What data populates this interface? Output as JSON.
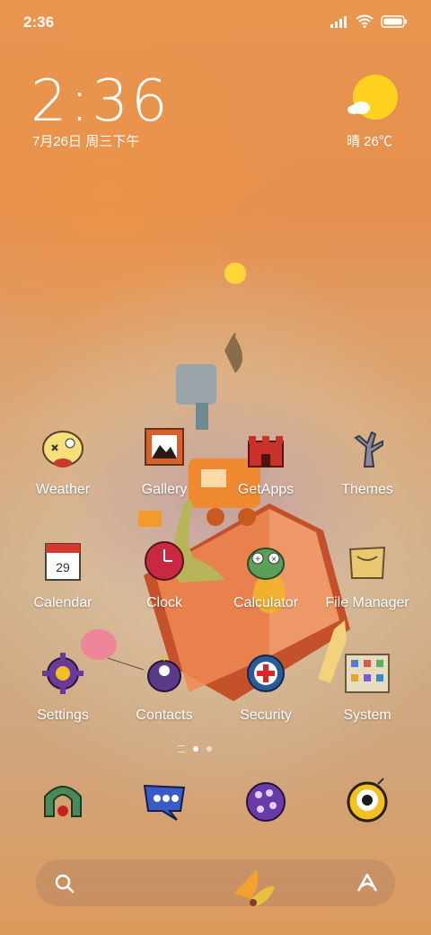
{
  "status_bar": {
    "time": "2:36"
  },
  "clock_widget": {
    "time": "2:36",
    "date": "7月26日 周三下午"
  },
  "weather_widget": {
    "text": "晴 26℃",
    "sun_color": "#ffd21f"
  },
  "apps": [
    {
      "label": "Weather",
      "icon": "bird-weather-icon"
    },
    {
      "label": "Gallery",
      "icon": "picture-frame-icon"
    },
    {
      "label": "GetApps",
      "icon": "castle-icon"
    },
    {
      "label": "Themes",
      "icon": "dead-tree-icon"
    },
    {
      "label": "Calendar",
      "icon": "calendar-page-icon"
    },
    {
      "label": "Clock",
      "icon": "red-clock-icon"
    },
    {
      "label": "Calculator",
      "icon": "frog-calculator-icon"
    },
    {
      "label": "File Manager",
      "icon": "paper-bag-icon"
    },
    {
      "label": "Settings",
      "icon": "purple-gear-icon"
    },
    {
      "label": "Contacts",
      "icon": "purple-monster-icon"
    },
    {
      "label": "Security",
      "icon": "red-cross-shield-icon"
    },
    {
      "label": "System",
      "icon": "map-grid-icon"
    }
  ],
  "dock": [
    {
      "icon": "phone-arch-icon"
    },
    {
      "icon": "message-bubble-icon"
    },
    {
      "icon": "browser-ball-icon"
    },
    {
      "icon": "camera-eye-icon"
    }
  ],
  "search_bar": {
    "search_icon": "search-icon",
    "assistant_icon": "assistant-icon"
  },
  "page_indicator": {
    "pages": 2,
    "current": 1
  }
}
